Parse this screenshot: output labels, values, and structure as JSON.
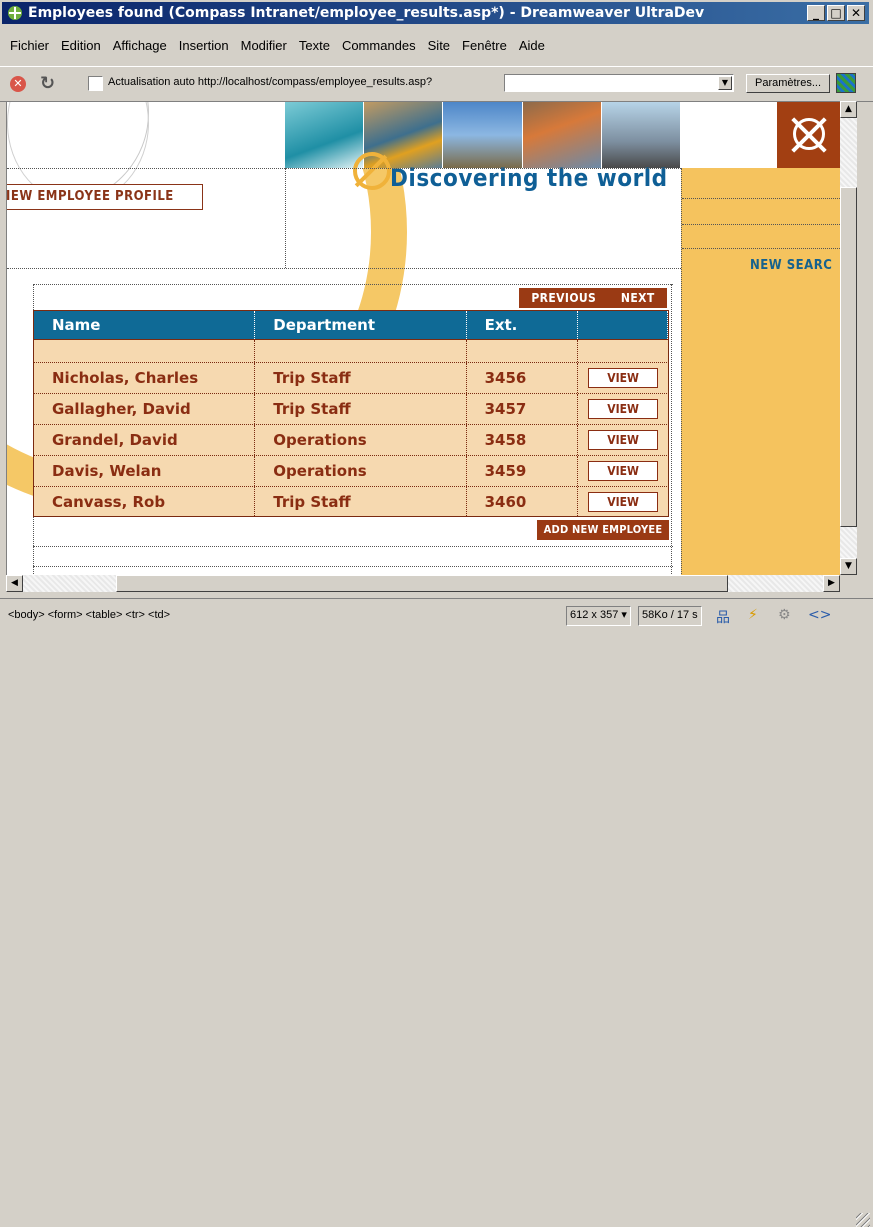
{
  "window": {
    "title": "Employees found (Compass Intranet/employee_results.asp*) - Dreamweaver UltraDev",
    "min_label": "_",
    "max_label": "□",
    "close_label": "✕"
  },
  "menu": [
    {
      "label": "Fichier"
    },
    {
      "label": "Edition"
    },
    {
      "label": "Affichage"
    },
    {
      "label": "Insertion"
    },
    {
      "label": "Modifier"
    },
    {
      "label": "Texte"
    },
    {
      "label": "Commandes"
    },
    {
      "label": "Site"
    },
    {
      "label": "Fenêtre"
    },
    {
      "label": "Aide"
    }
  ],
  "toolbar": {
    "auto_refresh_label": "Actualisation auto",
    "url": "http://localhost/compass/employee_results.asp?",
    "url_input_value": "",
    "params_label": "Paramètres..."
  },
  "page": {
    "profile_label": "IEW EMPLOYEE PROFILE",
    "logo_text": "Discovering the world",
    "new_search": "NEW SEARC",
    "nav": {
      "previous": "PREVIOUS",
      "next": "NEXT"
    },
    "table": {
      "headers": [
        "Name",
        "Department",
        "Ext."
      ],
      "rows": [
        {
          "name": "Nicholas, Charles",
          "department": "Trip Staff",
          "ext": "3456",
          "action": "VIEW"
        },
        {
          "name": "Gallagher, David",
          "department": "Trip Staff",
          "ext": "3457",
          "action": "VIEW"
        },
        {
          "name": "Grandel, David",
          "department": "Operations",
          "ext": "3458",
          "action": "VIEW"
        },
        {
          "name": "Davis, Welan",
          "department": "Operations",
          "ext": "3459",
          "action": "VIEW"
        },
        {
          "name": "Canvass, Rob",
          "department": "Trip Staff",
          "ext": "3460",
          "action": "VIEW"
        }
      ]
    },
    "add_employee": "ADD NEW EMPLOYEE"
  },
  "status": {
    "tag_selector": "<body> <form> <table> <tr> <td>",
    "window_size": "612 x 357",
    "download": "58Ko / 17 s"
  },
  "colors": {
    "accent_blue": "#0f6a96",
    "brand_rust": "#9a3a14",
    "sidebar_gold": "#f5c35e",
    "row_fill": "#f6d9b0"
  }
}
